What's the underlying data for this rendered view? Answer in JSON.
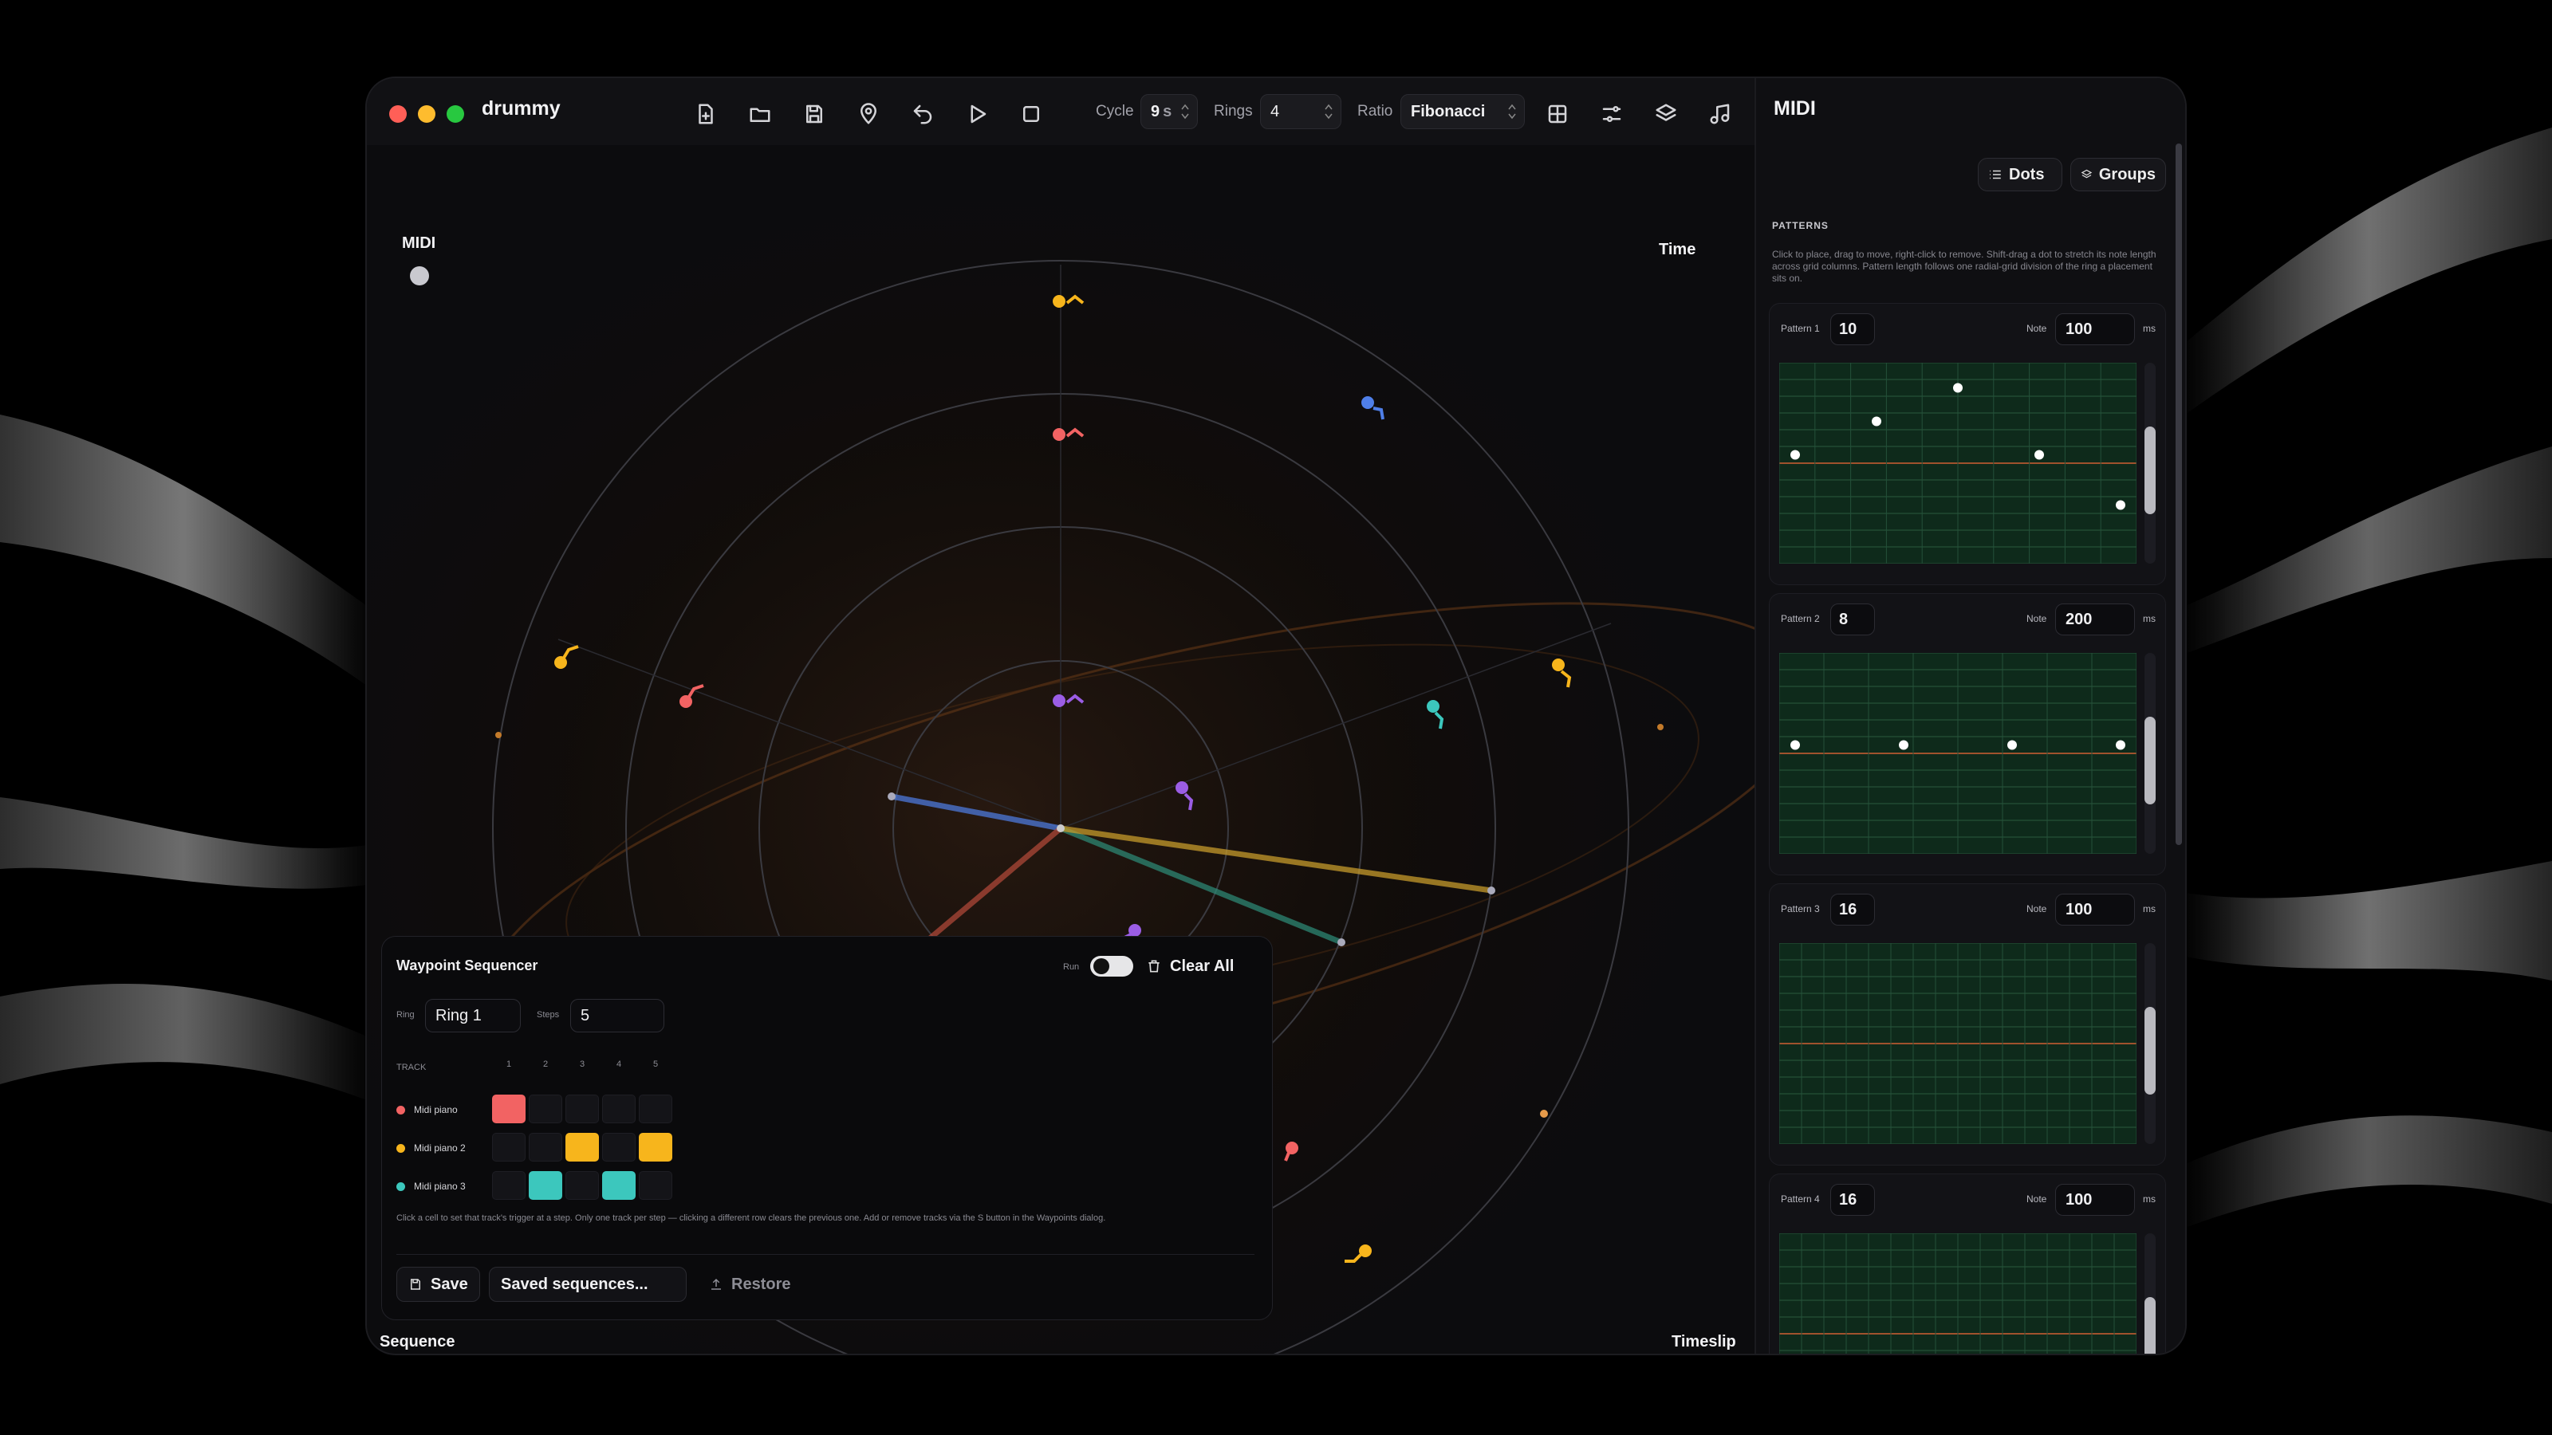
{
  "app": {
    "title": "drummy"
  },
  "toolbar": {
    "cycle_label": "Cycle",
    "cycle_value": "9",
    "cycle_unit": "s",
    "rings_label": "Rings",
    "rings_value": "4",
    "ratio_label": "Ratio",
    "ratio_value": "Fibonacci"
  },
  "stage": {
    "midi_label": "MIDI",
    "time_label": "Time",
    "sequence_label": "Sequence",
    "timeslip_label": "Timeslip"
  },
  "sequencer": {
    "title": "Waypoint Sequencer",
    "run_label": "Run",
    "run_on": true,
    "clear_label": "Clear All",
    "ring_label": "Ring",
    "ring_value": "Ring 1",
    "steps_label": "Steps",
    "steps_value": "5",
    "track_header": "TRACK",
    "columns": [
      "1",
      "2",
      "3",
      "4",
      "5"
    ],
    "tracks": [
      {
        "name": "Midi piano",
        "color": "#f26363",
        "active_steps": [
          1
        ]
      },
      {
        "name": "Midi piano 2",
        "color": "#f7b51c",
        "active_steps": [
          3,
          5
        ]
      },
      {
        "name": "Midi piano 3",
        "color": "#3cc7bd",
        "active_steps": [
          2,
          4
        ]
      }
    ],
    "help": "Click a cell to set that track's trigger at a step. Only one track per step — clicking a different row clears the previous one. Add or remove tracks via the S button in the Waypoints dialog.",
    "save_label": "Save",
    "saved_placeholder": "Saved sequences...",
    "restore_label": "Restore"
  },
  "panel": {
    "title": "MIDI",
    "dots_label": "Dots",
    "groups_label": "Groups",
    "section_label": "PATTERNS",
    "section_help": "Click to place, drag to move, right-click to remove. Shift-drag a dot to stretch its note length across grid columns. Pattern length follows one radial-grid division of the ring a placement sits on.",
    "note_label": "Note",
    "ms_label": "ms",
    "patterns": [
      {
        "label": "Pattern 1",
        "length": "10",
        "note": "100"
      },
      {
        "label": "Pattern 2",
        "length": "8",
        "note": "200"
      },
      {
        "label": "Pattern 3",
        "length": "16",
        "note": "100"
      },
      {
        "label": "Pattern 4",
        "length": "16",
        "note": "100"
      }
    ]
  },
  "colors": {
    "red": "#f26363",
    "yellow": "#f7b51c",
    "teal": "#3cc7bd",
    "purple": "#9b5de5",
    "blue": "#4f7fe8",
    "accent": "#1a73e8",
    "grid_green": "#123a24"
  },
  "icons": [
    "new-file-icon",
    "folder-icon",
    "save-icon",
    "location-pin-icon",
    "undo-icon",
    "play-icon",
    "stop-icon",
    "grid-icon",
    "sliders-icon",
    "layers-icon",
    "music-note-icon",
    "list-icon",
    "shuffle-icon",
    "signpost-icon",
    "trash-icon",
    "upload-icon"
  ]
}
